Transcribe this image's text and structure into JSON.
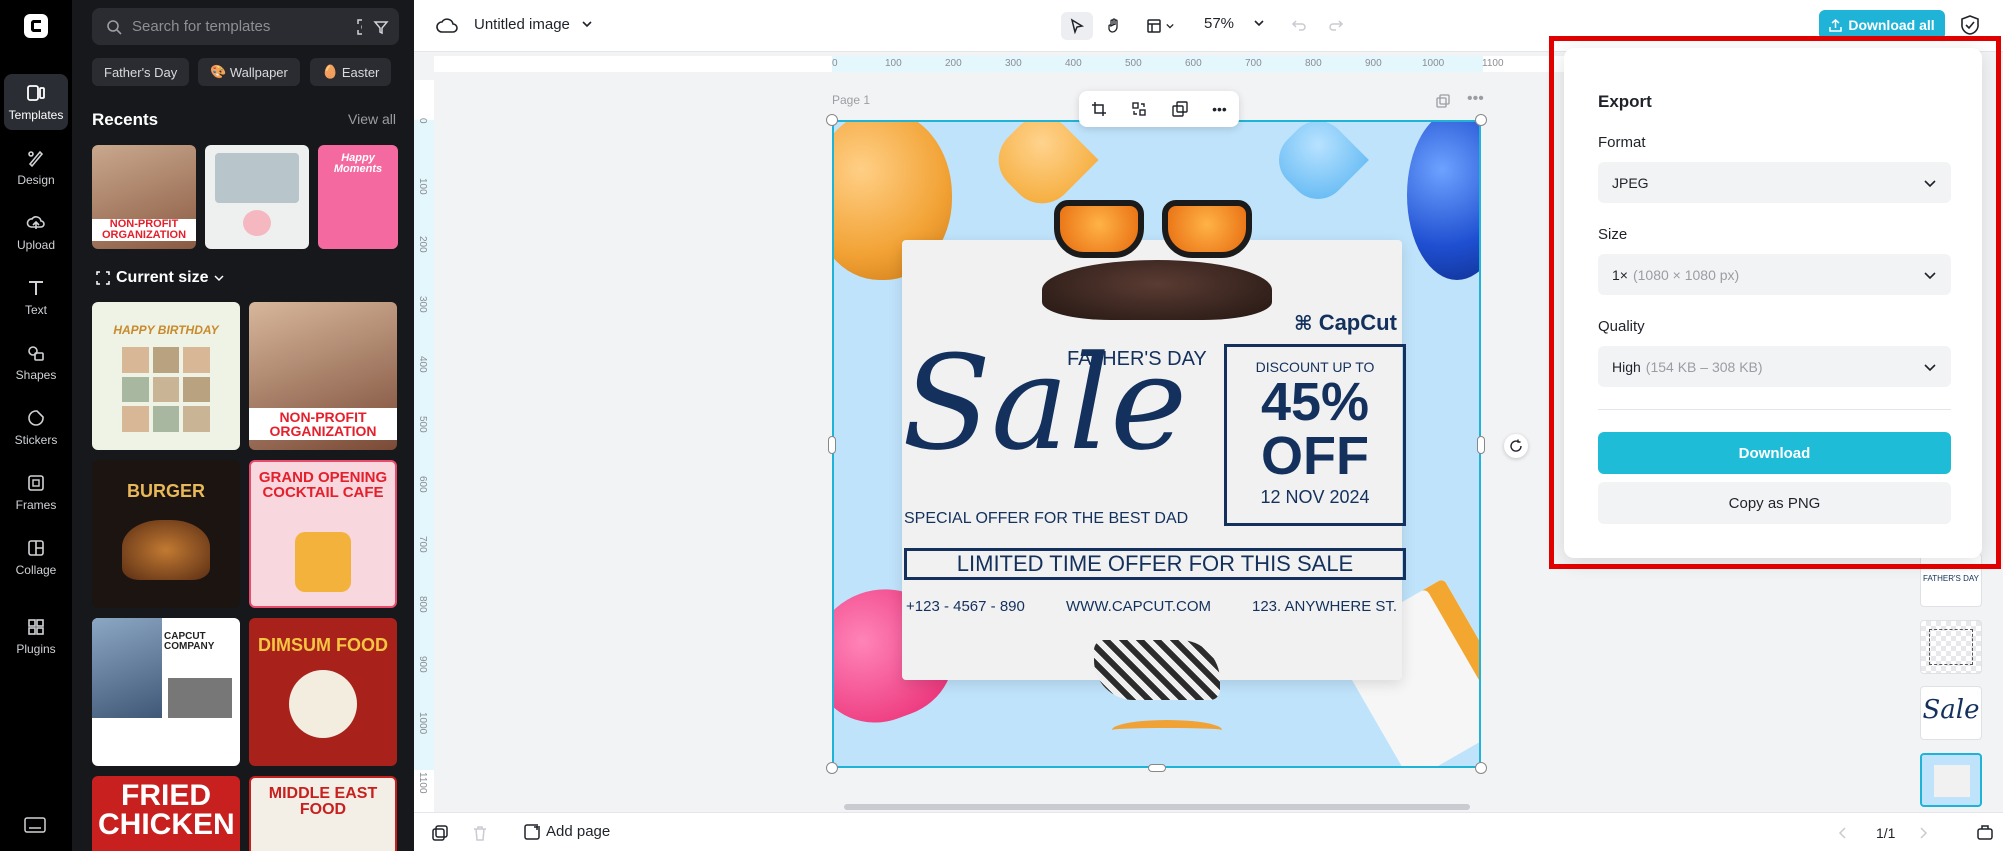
{
  "rail": {
    "items": [
      {
        "label": "Templates",
        "icon": "templates-icon"
      },
      {
        "label": "Design",
        "icon": "design-icon"
      },
      {
        "label": "Upload",
        "icon": "upload-icon"
      },
      {
        "label": "Text",
        "icon": "text-icon"
      },
      {
        "label": "Shapes",
        "icon": "shapes-icon"
      },
      {
        "label": "Stickers",
        "icon": "stickers-icon"
      },
      {
        "label": "Frames",
        "icon": "frames-icon"
      },
      {
        "label": "Collage",
        "icon": "collage-icon"
      },
      {
        "label": "Plugins",
        "icon": "plugins-icon"
      }
    ]
  },
  "panel": {
    "search_placeholder": "Search for templates",
    "chips": [
      "Father's Day",
      "Wallpaper",
      "Easter"
    ],
    "recents_title": "Recents",
    "view_all": "View all",
    "current_size": "Current size",
    "recent_thumbs": [
      "NON-PROFIT ORGANIZATION",
      "",
      "Happy Moments"
    ],
    "templates": [
      {
        "title": "HAPPY BIRTHDAY"
      },
      {
        "title": "NON-PROFIT ORGANIZATION"
      },
      {
        "title": "BURGER"
      },
      {
        "title": "GRAND OPENING COCKTAIL CAFE"
      },
      {
        "title": "CAPCUT COMPANY"
      },
      {
        "title": "DIMSUM FOOD"
      },
      {
        "title": "FRIED CHICKEN"
      },
      {
        "title": "MIDDLE EAST FOOD"
      }
    ]
  },
  "topbar": {
    "title": "Untitled image",
    "zoom": "57%",
    "download_all": "Download all"
  },
  "canvas": {
    "page_label": "Page 1",
    "ruler_top": [
      "0",
      "100",
      "200",
      "300",
      "400",
      "500",
      "600",
      "700",
      "800",
      "900",
      "1000",
      "1100"
    ],
    "ruler_left": [
      "0",
      "100",
      "200",
      "300",
      "400",
      "500",
      "600",
      "700",
      "800",
      "900",
      "1000",
      "1100"
    ],
    "design": {
      "brand": "CapCut",
      "fathers_day": "FATHER'S DAY",
      "sale": "Sale",
      "discount": "DISCOUNT UP TO",
      "percent": "45%",
      "off": "OFF",
      "date": "12 NOV 2024",
      "special": "SPECIAL OFFER FOR THE BEST DAD",
      "limited": "LIMITED TIME OFFER FOR THIS SALE",
      "phone": "+123 - 4567 - 890",
      "website": "WWW.CAPCUT.COM",
      "address": "123. ANYWHERE ST."
    }
  },
  "bottombar": {
    "add_page": "Add page",
    "pager": "1/1"
  },
  "thumbstrip": {
    "fathers_day": "FATHER'S DAY",
    "sale": "Sale"
  },
  "export": {
    "title": "Export",
    "format_label": "Format",
    "format_value": "JPEG",
    "size_label": "Size",
    "size_value": "1×",
    "size_sub": "(1080 × 1080 px)",
    "quality_label": "Quality",
    "quality_value": "High",
    "quality_sub": "(154 KB – 308 KB)",
    "download": "Download",
    "copy_png": "Copy as PNG"
  }
}
